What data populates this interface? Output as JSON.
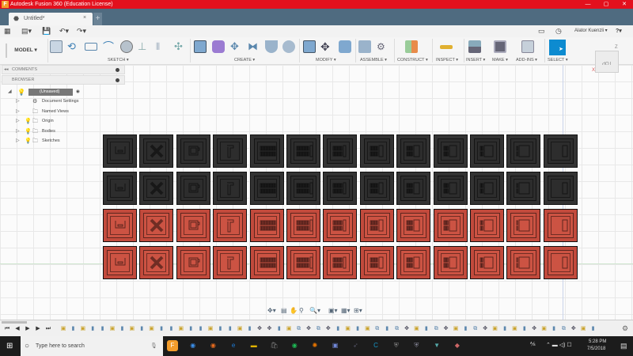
{
  "window": {
    "title": "Autodesk Fusion 360 (Education License)",
    "minimize": "—",
    "maximize": "▢",
    "close": "✕"
  },
  "tab": {
    "label": "Untitled*",
    "close": "×",
    "new": "+"
  },
  "quick_access": {
    "user": "Alator Kuenzli ▾",
    "help": "?▾"
  },
  "toolbar": {
    "workspace": "MODEL ▾",
    "groups": [
      {
        "label": "SKETCH ▾"
      },
      {
        "label": "CREATE ▾"
      },
      {
        "label": "MODIFY ▾"
      },
      {
        "label": "ASSEMBLE ▾"
      },
      {
        "label": "CONSTRUCT ▾"
      },
      {
        "label": "INSPECT ▾"
      },
      {
        "label": "INSERT ▾"
      },
      {
        "label": "MAKE ▾"
      },
      {
        "label": "ADD-INS ▾"
      },
      {
        "label": "SELECT ▾"
      }
    ],
    "accent": "#0d8bd0"
  },
  "panels": {
    "comments": "COMMENTS",
    "browser": "BROWSER"
  },
  "browser": {
    "root": "(Unsaved)",
    "items": [
      {
        "label": "Document Settings",
        "icon": "gear-icon"
      },
      {
        "label": "Named Views",
        "icon": "folder-icon"
      },
      {
        "label": "Origin",
        "icon": "folder-icon",
        "bulb": "off"
      },
      {
        "label": "Bodies",
        "icon": "folder-icon",
        "bulb": "on"
      },
      {
        "label": "Sketches",
        "icon": "folder-icon",
        "bulb": "on"
      }
    ]
  },
  "viewcube": {
    "face": "TOP",
    "axis_z": "Z",
    "axis_x": "X"
  },
  "model": {
    "rows": [
      "dark",
      "dark",
      "red",
      "red"
    ],
    "columns": [
      "floppy",
      "x",
      "battery",
      "bracket",
      "bars10",
      "bars8",
      "bars6",
      "bars5",
      "bars4",
      "bars3",
      "bars2",
      "bars1",
      "bar0"
    ],
    "colors": {
      "dark": "#333333",
      "red": "#c24a3c"
    }
  },
  "timeline": {
    "controls": [
      "⏮",
      "◀",
      "▶",
      "▶",
      "⏭"
    ],
    "features": [
      "s",
      "e",
      "s",
      "e",
      "e",
      "s",
      "e",
      "s",
      "e",
      "s",
      "e",
      "e",
      "s",
      "e",
      "e",
      "s",
      "e",
      "e",
      "s",
      "e",
      "m",
      "m",
      "e",
      "s",
      "c",
      "m",
      "c",
      "m",
      "e",
      "s",
      "e",
      "s",
      "c",
      "e",
      "c",
      "m",
      "s",
      "e",
      "c",
      "m",
      "s",
      "e",
      "c",
      "m",
      "s",
      "e",
      "s",
      "e",
      "m",
      "s",
      "e",
      "c",
      "m",
      "s",
      "e"
    ]
  },
  "taskbar": {
    "search_placeholder": "Type here to search",
    "apps": [
      "Fusion 360",
      "Chrome",
      "Firefox",
      "Edge",
      "Explorer",
      "Store",
      "Spotify",
      "Blender",
      "Discord",
      "Steam",
      "Cura",
      "Steam app",
      "Game",
      "Vpn",
      "App"
    ],
    "time": "5:28 PM",
    "date": "7/5/2018"
  }
}
